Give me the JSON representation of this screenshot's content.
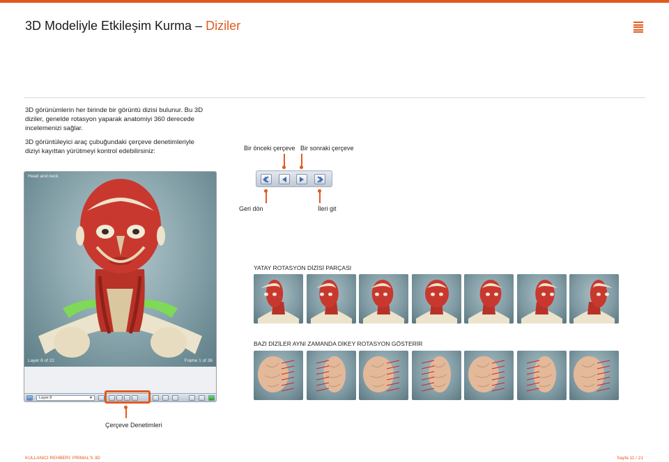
{
  "header": {
    "title_main": "3D Modeliyle Etkileşim Kurma – ",
    "title_sub": "Diziler",
    "menu_icon": "menu-lines-icon"
  },
  "body": {
    "paragraph1": "3D görünümlerin her birinde bir görüntü dizisi bulunur. Bu 3D diziler, genelde rotasyon yaparak anatomiyi 360 derecede incelemenizi sağlar.",
    "paragraph2": "3D görüntüleyici araç çubuğundaki çerçeve denetimleriyle diziyi kayıttan yürütmeyi kontrol edebilirsiniz:"
  },
  "viewer": {
    "view_label": "Head and neck",
    "layer_status": "Layer 8 of 22",
    "frame_status": "Frame 1 of 36",
    "layer_select_value": "Layer 8",
    "frame_controls_caption": "Çerçeve Denetimleri"
  },
  "controls": {
    "prev_frame_label": "Bir önceki çerçeve",
    "next_frame_label": "Bir sonraki çerçeve",
    "rewind_label": "Geri dön",
    "forward_label": "İleri git",
    "icons": [
      "rewind-icon",
      "prev-frame-icon",
      "next-frame-icon",
      "forward-icon"
    ]
  },
  "sequences": {
    "horizontal_title": "YATAY ROTASYON DİZİSİ PARÇASI",
    "vertical_title": "BAZI DİZİLER AYNI ZAMANDA DİKEY ROTASYON GÖSTERİR",
    "horizontal_count": 7,
    "vertical_count": 7
  },
  "footer": {
    "left": "KULLANICI REHBERİ: PRIMAL'S 3D",
    "right": "Sayfa 11 / 21"
  },
  "colors": {
    "accent": "#e05a1e",
    "muscle": "#c9382e",
    "bone": "#ece3cc",
    "highlight_bone": "#7ed957"
  }
}
